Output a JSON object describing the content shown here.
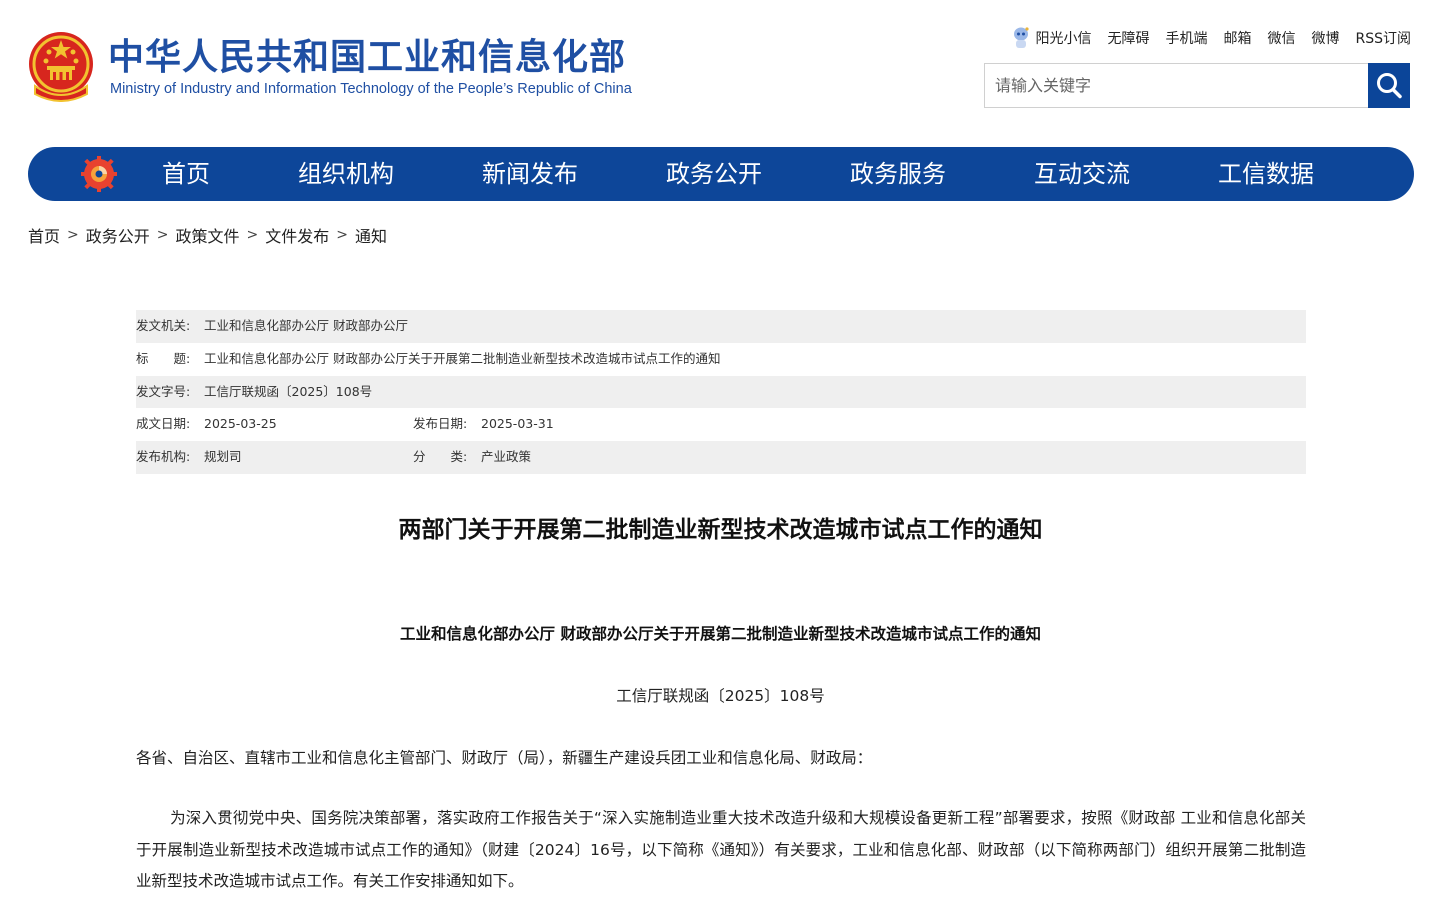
{
  "header": {
    "logo_cn": "中华人民共和国工业和信息化部",
    "logo_en": "Ministry of Industry and Information Technology of the People’s Republic of China",
    "top_links": [
      "阳光小信",
      "无障碍",
      "手机端",
      "邮箱",
      "微信",
      "微博",
      "RSS订阅"
    ],
    "search_placeholder": "请输入关键字"
  },
  "nav": {
    "items": [
      "首页",
      "组织机构",
      "新闻发布",
      "政务公开",
      "政务服务",
      "互动交流",
      "工信数据"
    ]
  },
  "breadcrumb": [
    "首页",
    "政务公开",
    "政策文件",
    "文件发布",
    "通知"
  ],
  "meta": {
    "issuer_key": "发文机关:",
    "issuer": "工业和信息化部办公厅 财政部办公厅",
    "title_key": "标　　题:",
    "title": "工业和信息化部办公厅 财政部办公厅关于开展第二批制造业新型技术改造城市试点工作的通知",
    "docno_key": "发文字号:",
    "docno": "工信厅联规函〔2025〕108号",
    "created_key": "成文日期:",
    "created": "2025-03-25",
    "published_key": "发布日期:",
    "published": "2025-03-31",
    "org_key": "发布机构:",
    "org": "规划司",
    "category_key": "分　　类:",
    "category": "产业政策"
  },
  "article": {
    "title": "两部门关于开展第二批制造业新型技术改造城市试点工作的通知",
    "subtitle": "工业和信息化部办公厅  财政部办公厅关于开展第二批制造业新型技术改造城市试点工作的通知",
    "doc_no": "工信厅联规函〔2025〕108号",
    "addressee": "各省、自治区、直辖市工业和信息化主管部门、财政厅（局），新疆生产建设兵团工业和信息化局、财政局：",
    "paragraph1": "为深入贯彻党中央、国务院决策部署，落实政府工作报告关于“深入实施制造业重大技术改造升级和大规模设备更新工程”部署要求，按照《财政部 工业和信息化部关于开展制造业新型技术改造城市试点工作的通知》（财建〔2024〕16号，以下简称《通知》）有关要求，工业和信息化部、财政部（以下简称两部门）组织开展第二批制造业新型技术改造城市试点工作。有关工作安排通知如下。"
  },
  "colors": {
    "brand_blue": "#0d4699",
    "logo_blue": "#1f4fa3",
    "meta_shade": "#efefef"
  }
}
